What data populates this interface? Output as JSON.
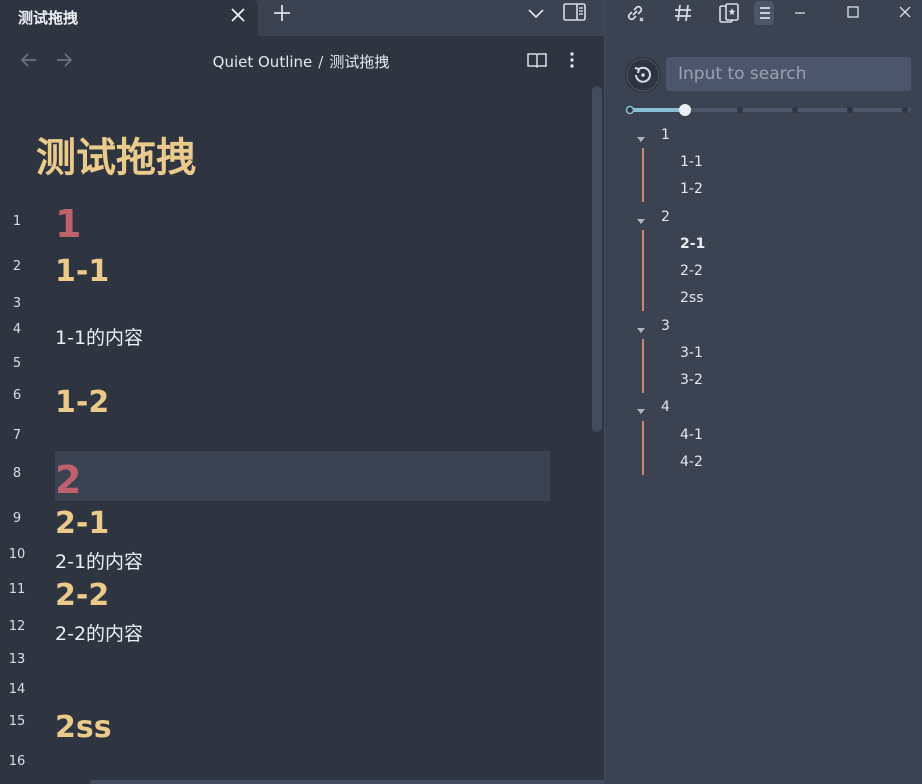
{
  "tab": {
    "title": "测试拖拽",
    "close_icon": "close-icon",
    "new_tab_icon": "plus-icon"
  },
  "breadcrumb": {
    "folder": "Quiet Outline",
    "separator": "/",
    "file": "测试拖拽"
  },
  "document": {
    "title": "测试拖拽",
    "lines": [
      {
        "num": "1",
        "text": "1",
        "kind": "h1"
      },
      {
        "num": "2",
        "text": "1-1",
        "kind": "h2"
      },
      {
        "num": "3",
        "text": "",
        "kind": "para"
      },
      {
        "num": "4",
        "text": "1-1的内容",
        "kind": "para"
      },
      {
        "num": "5",
        "text": "",
        "kind": "para"
      },
      {
        "num": "6",
        "text": "1-2",
        "kind": "h2"
      },
      {
        "num": "7",
        "text": "",
        "kind": "para"
      },
      {
        "num": "8",
        "text": "2",
        "kind": "h1"
      },
      {
        "num": "9",
        "text": "2-1",
        "kind": "h2"
      },
      {
        "num": "10",
        "text": "2-1的内容",
        "kind": "para"
      },
      {
        "num": "11",
        "text": "2-2",
        "kind": "h2"
      },
      {
        "num": "12",
        "text": "2-2的内容",
        "kind": "para"
      },
      {
        "num": "13",
        "text": "",
        "kind": "para"
      },
      {
        "num": "14",
        "text": "",
        "kind": "para"
      },
      {
        "num": "15",
        "text": "2ss",
        "kind": "h2"
      },
      {
        "num": "16",
        "text": "",
        "kind": "para"
      }
    ],
    "active_line": "8"
  },
  "outline": {
    "search_placeholder": "Input to search",
    "level_slider": {
      "levels": 6,
      "selected": 2
    },
    "items": [
      {
        "label": "1",
        "level": 1,
        "collapsible": true
      },
      {
        "label": "1-1",
        "level": 2
      },
      {
        "label": "1-2",
        "level": 2
      },
      {
        "label": "2",
        "level": 1,
        "collapsible": true
      },
      {
        "label": "2-1",
        "level": 2,
        "current": true
      },
      {
        "label": "2-2",
        "level": 2
      },
      {
        "label": "2ss",
        "level": 2
      },
      {
        "label": "3",
        "level": 1,
        "collapsible": true
      },
      {
        "label": "3-1",
        "level": 2
      },
      {
        "label": "3-2",
        "level": 2
      },
      {
        "label": "4",
        "level": 1,
        "collapsible": true
      },
      {
        "label": "4-1",
        "level": 2
      },
      {
        "label": "4-2",
        "level": 2
      }
    ]
  },
  "colors": {
    "background": "#2e3440",
    "panel": "#3b4252",
    "h1": "#bf616a",
    "h2": "#ebcb8b",
    "outline_bar": "#d08770",
    "slider_accent": "#88c0d0"
  }
}
